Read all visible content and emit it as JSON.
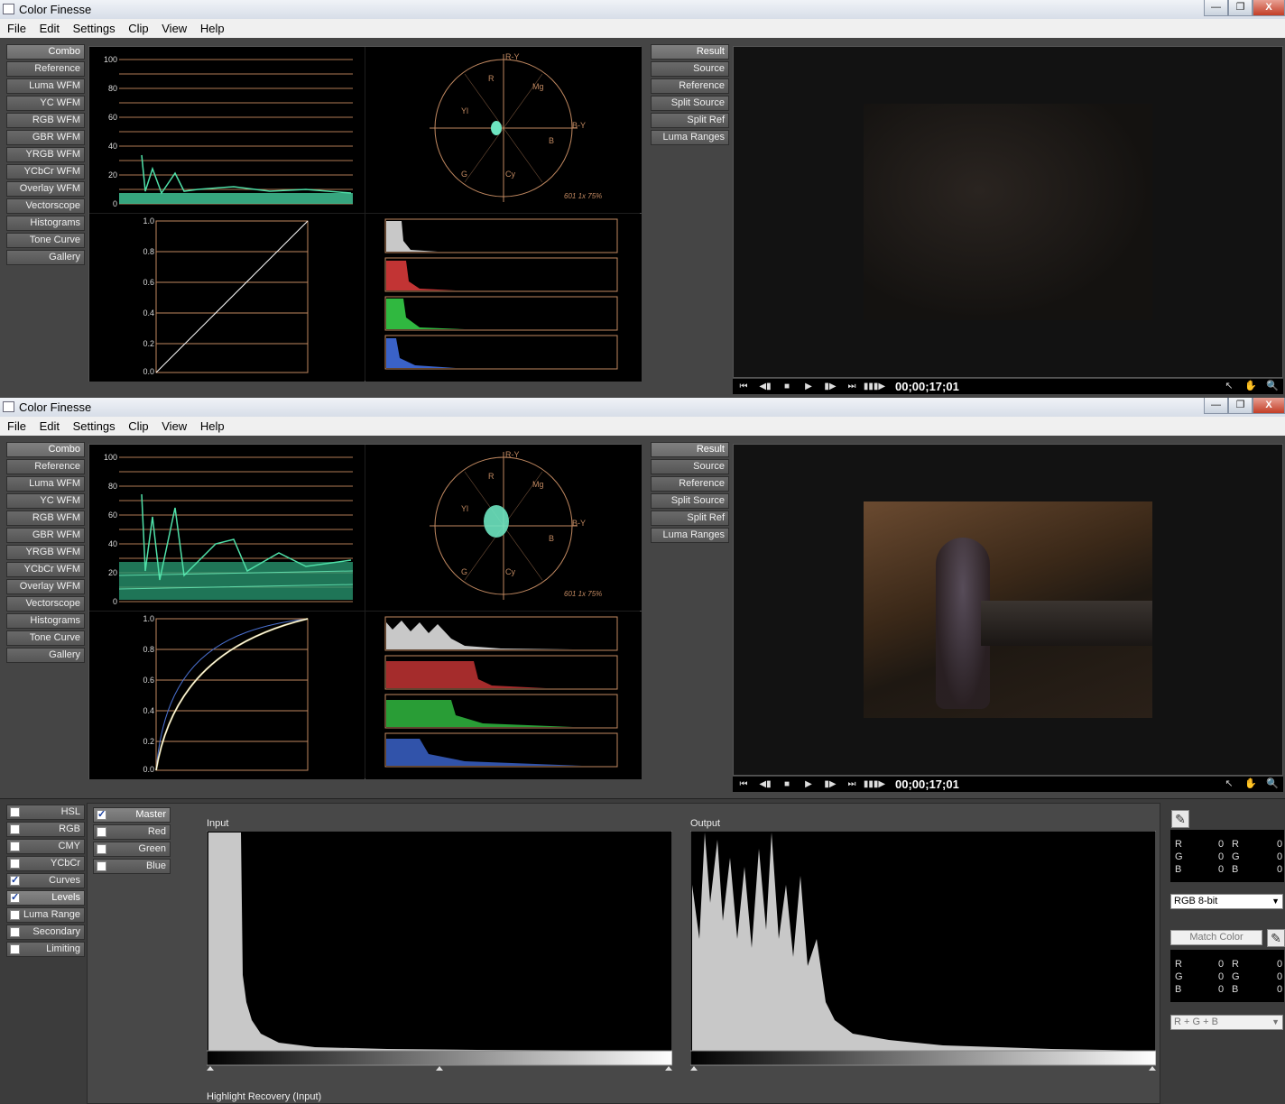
{
  "windows": [
    {
      "title": "Color Finesse",
      "timecode": "00;00;17;01"
    },
    {
      "title": "Color Finesse",
      "timecode": "00;00;17;01"
    }
  ],
  "window_controls": {
    "minimize": "—",
    "maximize": "❐",
    "close": "X"
  },
  "menu": [
    "File",
    "Edit",
    "Settings",
    "Clip",
    "View",
    "Help"
  ],
  "analysis_tabs": [
    "Combo",
    "Reference",
    "Luma WFM",
    "YC WFM",
    "RGB WFM",
    "GBR WFM",
    "YRGB WFM",
    "YCbCr WFM",
    "Overlay WFM",
    "Vectorscope",
    "Histograms",
    "Tone Curve",
    "Gallery"
  ],
  "view_tabs": [
    "Result",
    "Source",
    "Reference",
    "Split Source",
    "Split Ref",
    "Luma Ranges"
  ],
  "waveform_ticks": [
    "100",
    "80",
    "60",
    "40",
    "20",
    "0"
  ],
  "curve_ticks": [
    "1.0",
    "0.8",
    "0.6",
    "0.4",
    "0.2",
    "0.0"
  ],
  "vectorscope": {
    "labels": {
      "ry": "R-Y",
      "by": "B-Y",
      "r": "R",
      "mg": "Mg",
      "yl": "Yl",
      "b": "B",
      "g": "G",
      "cy": "Cy"
    },
    "standard": "601 1x 75%"
  },
  "transport": {
    "first": "⏮",
    "prev": "◀▮",
    "stop": "■",
    "play": "▶",
    "next": "▮▶",
    "last": "⏭",
    "loop": "▮▮▮▶",
    "arrow_tool": "↖",
    "hand_tool": "✋",
    "zoom_tool": "🔍"
  },
  "correction_tabs": [
    {
      "label": "HSL",
      "checked": false
    },
    {
      "label": "RGB",
      "checked": false
    },
    {
      "label": "CMY",
      "checked": false
    },
    {
      "label": "YCbCr",
      "checked": false
    },
    {
      "label": "Curves",
      "checked": true
    },
    {
      "label": "Levels",
      "checked": true
    },
    {
      "label": "Luma Range",
      "checked": false
    },
    {
      "label": "Secondary",
      "checked": false
    },
    {
      "label": "Limiting",
      "checked": false
    }
  ],
  "channels": [
    {
      "label": "Master",
      "checked": true
    },
    {
      "label": "Red",
      "checked": false
    },
    {
      "label": "Green",
      "checked": false
    },
    {
      "label": "Blue",
      "checked": false
    }
  ],
  "levels": {
    "input_label": "Input",
    "output_label": "Output",
    "highlight_label": "Highlight Recovery (Input)"
  },
  "sampler": {
    "rows": [
      {
        "a": "R",
        "av": "0",
        "b": "R",
        "bv": "0"
      },
      {
        "a": "G",
        "av": "0",
        "b": "G",
        "bv": "0"
      },
      {
        "a": "B",
        "av": "0",
        "b": "B",
        "bv": "0"
      }
    ],
    "mode": "RGB 8-bit",
    "match_color": "Match Color",
    "match_mode": "R + G + B"
  },
  "colors": {
    "wave": "#4fe0a8",
    "scope_line": "#c08860",
    "accent_white": "#ffffff"
  }
}
